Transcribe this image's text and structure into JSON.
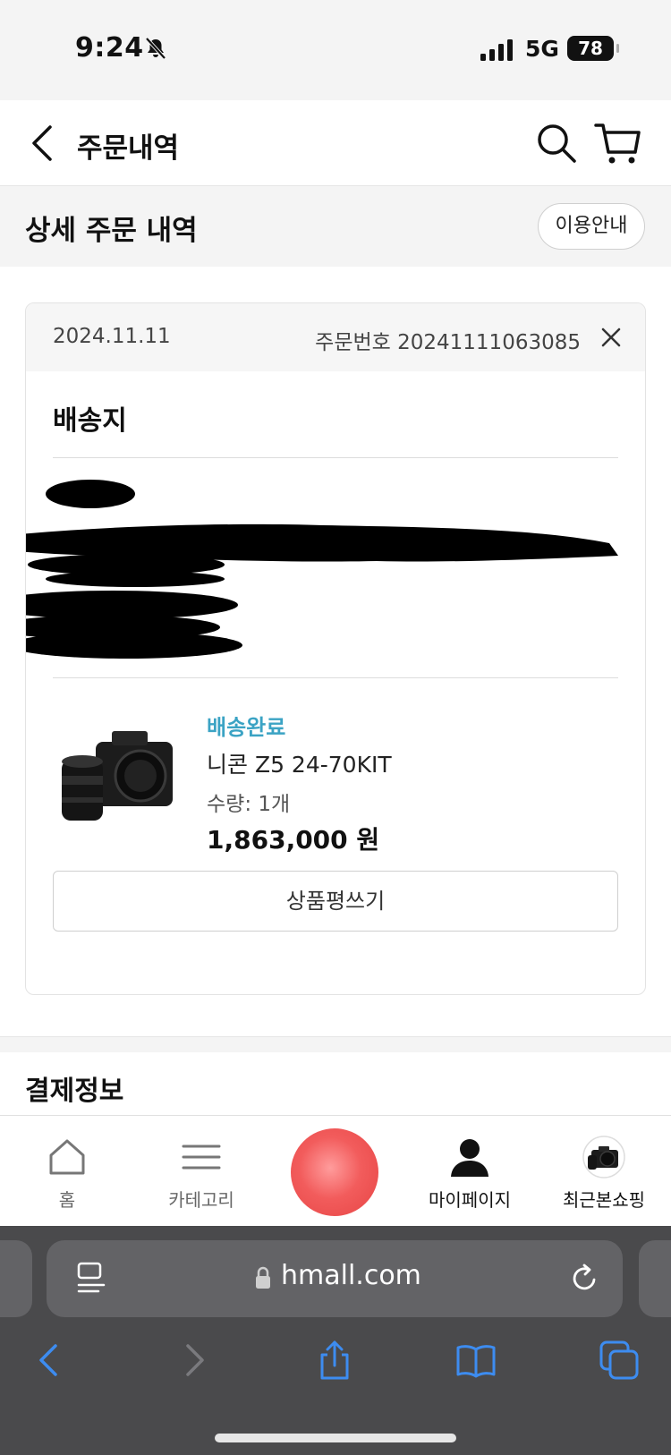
{
  "status_bar": {
    "time": "9:24",
    "network": "5G",
    "battery": "78"
  },
  "header": {
    "title": "주문내역"
  },
  "section": {
    "title": "상세 주문 내역",
    "guide_label": "이용안내"
  },
  "order": {
    "date": "2024.11.11",
    "order_number": "주문번호 20241111063085",
    "shipping_title": "배송지",
    "product": {
      "status": "배송완료",
      "name": "니콘 Z5 24-70KIT",
      "quantity": "수량: 1개",
      "price": "1,863,000 원"
    },
    "review_label": "상품평쓰기"
  },
  "payment": {
    "title": "결제정보"
  },
  "bottom_nav": {
    "items": [
      {
        "label": "홈"
      },
      {
        "label": "카테고리"
      },
      {
        "label": "마이페이지"
      },
      {
        "label": "최근본쇼핑"
      }
    ]
  },
  "browser": {
    "url": "hmall.com"
  },
  "colors": {
    "accent_status": "#3ba3c4",
    "center_button": "#f25c5c",
    "browser_bg": "#4a4a4c",
    "browser_icon": "#3d8cf0"
  }
}
